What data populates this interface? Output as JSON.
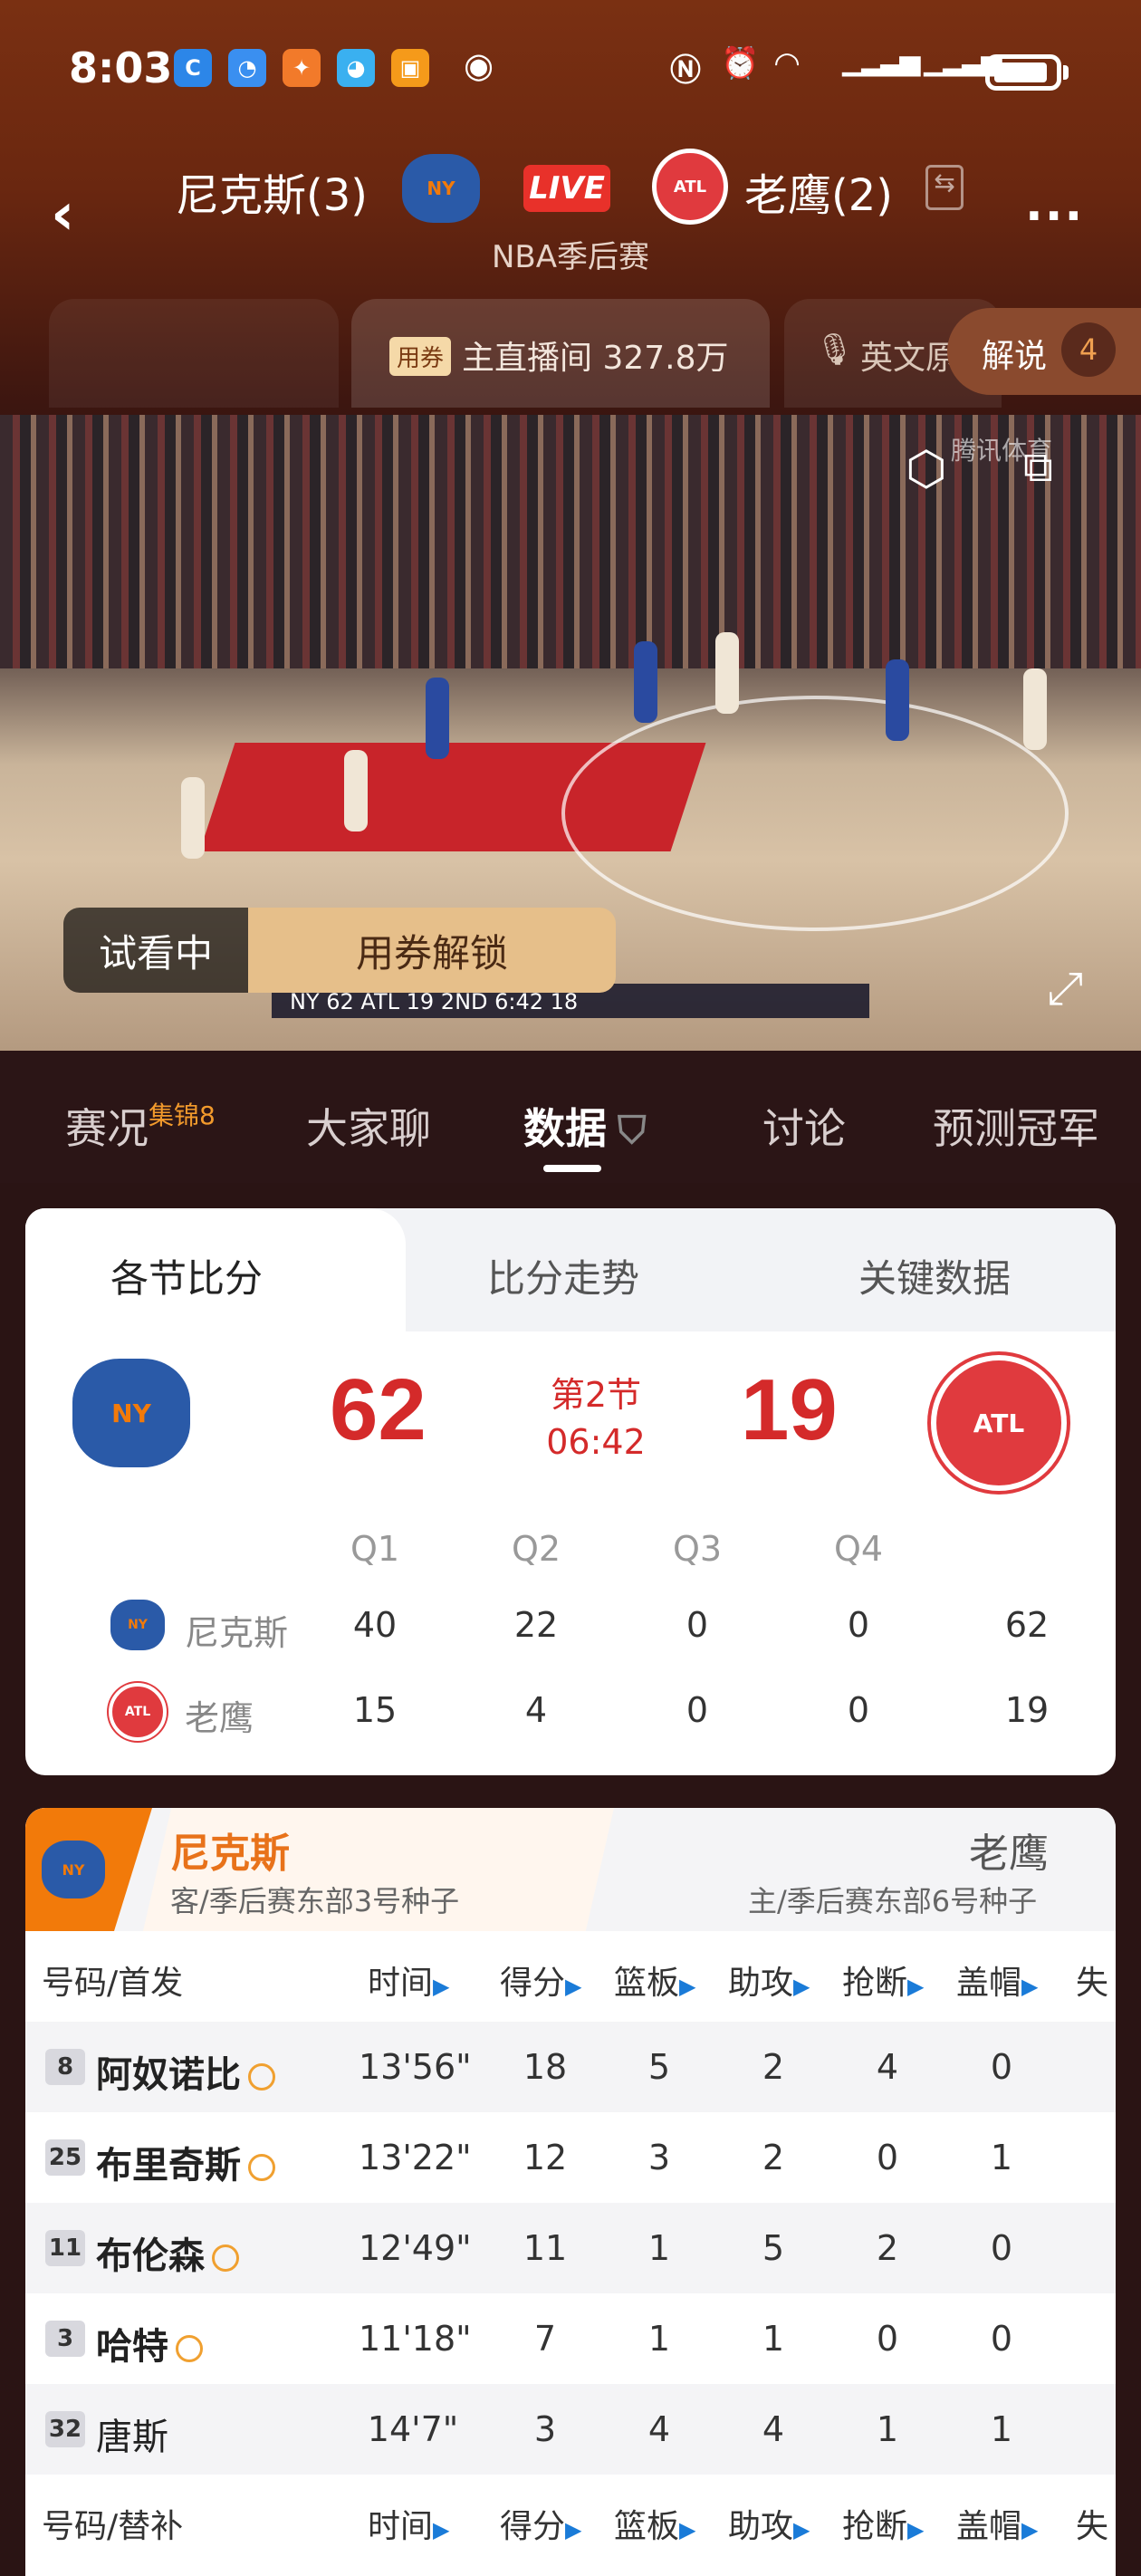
{
  "status_bar": {
    "time": "8:03",
    "app_icons": [
      "app-icon-1",
      "app-icon-2",
      "app-icon-3",
      "app-icon-4",
      "app-icon-5"
    ]
  },
  "header": {
    "home_team": "尼克斯(3)",
    "away_team": "老鹰(2)",
    "live_label": "LIVE",
    "subtitle": "NBA季后赛",
    "more_label": "..."
  },
  "streams": {
    "ticket_badge": "用券",
    "main_label": "主直播间 327.8万",
    "english_label": "英文原",
    "commentary_label": "解说",
    "commentary_count": "4"
  },
  "video": {
    "watermark": "腾讯体育",
    "trial_label": "试看中",
    "unlock_label": "用券解锁",
    "scorebug": "NY 62   ATL 19   2ND 6:42  18"
  },
  "tabs": [
    {
      "label": "赛况",
      "sup": "集锦8"
    },
    {
      "label": "大家聊",
      "sup": ""
    },
    {
      "label": "数据",
      "sup": ""
    },
    {
      "label": "讨论",
      "sup": ""
    },
    {
      "label": "预测冠军",
      "sup": ""
    }
  ],
  "score_card": {
    "subtabs": [
      "各节比分",
      "比分走势",
      "关键数据"
    ],
    "home_score": "62",
    "away_score": "19",
    "period": "第2节",
    "clock": "06:42",
    "quarters": [
      "Q1",
      "Q2",
      "Q3",
      "Q4"
    ],
    "rows": [
      {
        "team": "尼克斯",
        "q": [
          "40",
          "22",
          "0",
          "0"
        ],
        "total": "62"
      },
      {
        "team": "老鹰",
        "q": [
          "15",
          "4",
          "0",
          "0"
        ],
        "total": "19"
      }
    ]
  },
  "box_score": {
    "home_name": "尼克斯",
    "home_desc": "客/季后赛东部3号种子",
    "away_name": "老鹰",
    "away_desc": "主/季后赛东部6号种子",
    "columns": [
      "号码/首发",
      "时间",
      "得分",
      "篮板",
      "助攻",
      "抢断",
      "盖帽",
      "失"
    ],
    "starters": [
      {
        "num": "8",
        "name": "阿奴诺比",
        "starter": true,
        "time": "13'56\"",
        "pts": "18",
        "reb": "5",
        "ast": "2",
        "stl": "4",
        "blk": "0"
      },
      {
        "num": "25",
        "name": "布里奇斯",
        "starter": true,
        "time": "13'22\"",
        "pts": "12",
        "reb": "3",
        "ast": "2",
        "stl": "0",
        "blk": "1"
      },
      {
        "num": "11",
        "name": "布伦森",
        "starter": true,
        "time": "12'49\"",
        "pts": "11",
        "reb": "1",
        "ast": "5",
        "stl": "2",
        "blk": "0"
      },
      {
        "num": "3",
        "name": "哈特",
        "starter": true,
        "time": "11'18\"",
        "pts": "7",
        "reb": "1",
        "ast": "1",
        "stl": "0",
        "blk": "0"
      },
      {
        "num": "32",
        "name": "唐斯",
        "starter": false,
        "time": "14'7\"",
        "pts": "3",
        "reb": "4",
        "ast": "4",
        "stl": "1",
        "blk": "1"
      }
    ],
    "bench_header": "号码/替补"
  },
  "colors": {
    "accent_red": "#d42a2a",
    "knicks_orange": "#f27a0a",
    "live_red": "#e8312a"
  }
}
